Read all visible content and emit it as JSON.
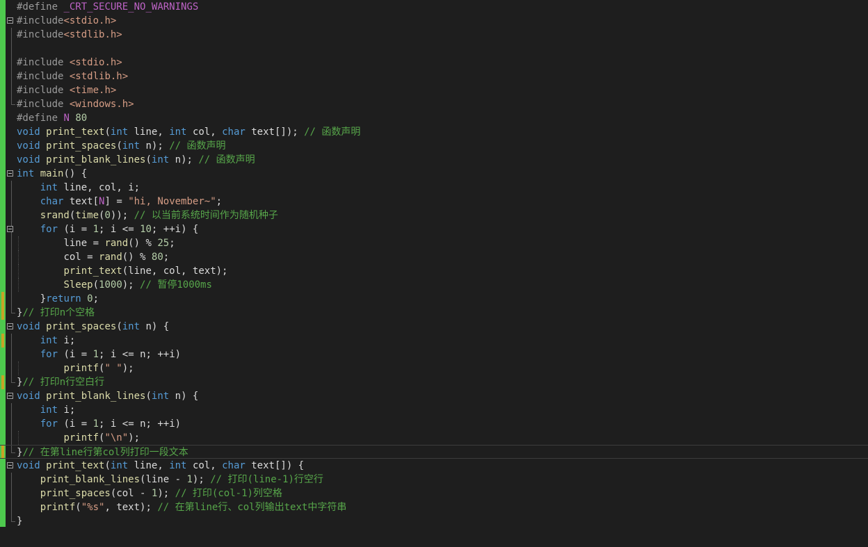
{
  "editor": {
    "lines": [
      "#define _CRT_SECURE_NO_WARNINGS",
      "#include<stdio.h>",
      "#include<stdlib.h>",
      "",
      "#include <stdio.h>",
      "#include <stdlib.h>",
      "#include <time.h>",
      "#include <windows.h>",
      "#define N 80",
      "void print_text(int line, int col, char text[]); // 函数声明",
      "void print_spaces(int n); // 函数声明",
      "void print_blank_lines(int n); // 函数声明",
      "int main() {",
      "    int line, col, i;",
      "    char text[N] = \"hi, November~\";",
      "    srand(time(0)); // 以当前系统时间作为随机种子",
      "    for (i = 1; i <= 10; ++i) {",
      "        line = rand() % 25;",
      "        col = rand() % 80;",
      "        print_text(line, col, text);",
      "        Sleep(1000); // 暂停1000ms",
      "    }return 0;",
      "}// 打印n个空格",
      "void print_spaces(int n) {",
      "    int i;",
      "    for (i = 1; i <= n; ++i)",
      "        printf(\" \");",
      "}// 打印n行空白行",
      "void print_blank_lines(int n) {",
      "    int i;",
      "    for (i = 1; i <= n; ++i)",
      "        printf(\"\\n\");",
      "}// 在第line行第col列打印一段文本",
      "void print_text(int line, int col, char text[]) {",
      "    print_blank_lines(line - 1); // 打印(line-1)行空行",
      "    print_spaces(col - 1); // 打印(col-1)列空格",
      "    printf(\"%s\", text); // 在第line行、col列输出text中字符串",
      "}"
    ],
    "current_line_index": 32,
    "colors": {
      "background": "#1e1e1e",
      "keyword": "#569cd6",
      "preprocessor": "#9b9b9b",
      "string": "#d69d85",
      "comment": "#57a64a",
      "function": "#dcdcaa",
      "macro": "#bd63c5",
      "change_saved": "#4ec94e",
      "change_unsaved": "#c9a227"
    }
  }
}
